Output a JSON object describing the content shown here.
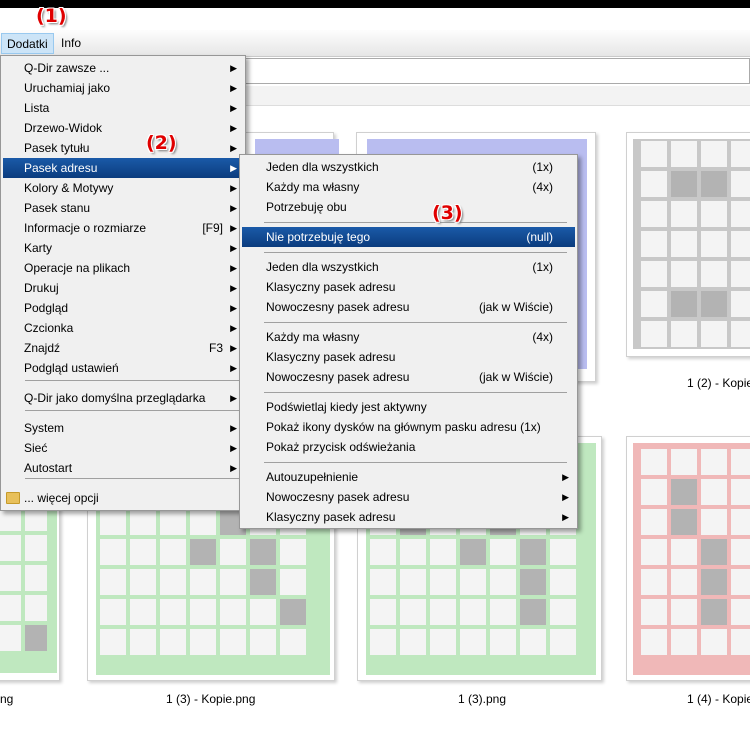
{
  "annotations": {
    "a1": "(1)",
    "a2": "(2)",
    "a3": "(3)"
  },
  "menubar": {
    "dodatki": "Dodatki",
    "info": "Info"
  },
  "main_menu": {
    "items": [
      {
        "label": "Q-Dir zawsze ...",
        "shortcut": "",
        "arrow": "▶"
      },
      {
        "label": "Uruchamiaj jako",
        "shortcut": "",
        "arrow": "▶"
      },
      {
        "label": "Lista",
        "shortcut": "",
        "arrow": "▶"
      },
      {
        "label": "Drzewo-Widok",
        "shortcut": "",
        "arrow": "▶"
      },
      {
        "label": "Pasek tytułu",
        "shortcut": "",
        "arrow": "▶"
      },
      {
        "label": "Pasek adresu",
        "shortcut": "",
        "arrow": "▶"
      },
      {
        "label": "Kolory & Motywy",
        "shortcut": "",
        "arrow": "▶"
      },
      {
        "label": "Pasek stanu",
        "shortcut": "",
        "arrow": "▶"
      },
      {
        "label": "Informacje o rozmiarze",
        "shortcut": "[F9]",
        "arrow": "▶"
      },
      {
        "label": "Karty",
        "shortcut": "",
        "arrow": "▶"
      },
      {
        "label": "Operacje na plikach",
        "shortcut": "",
        "arrow": "▶"
      },
      {
        "label": "Drukuj",
        "shortcut": "",
        "arrow": "▶"
      },
      {
        "label": "Podgląd",
        "shortcut": "",
        "arrow": "▶"
      },
      {
        "label": "Czcionka",
        "shortcut": "",
        "arrow": "▶"
      },
      {
        "label": "Znajdź",
        "shortcut": "F3",
        "arrow": "▶"
      },
      {
        "label": "Podgląd ustawień",
        "shortcut": "",
        "arrow": "▶"
      },
      {
        "label": "Q-Dir jako domyślna przeglądarka",
        "shortcut": "",
        "arrow": "▶"
      },
      {
        "label": "System",
        "shortcut": "",
        "arrow": "▶"
      },
      {
        "label": "Sieć",
        "shortcut": "",
        "arrow": "▶"
      },
      {
        "label": "Autostart",
        "shortcut": "",
        "arrow": "▶"
      },
      {
        "label": "... więcej opcji",
        "shortcut": "",
        "arrow": ""
      }
    ]
  },
  "submenu": {
    "items": [
      {
        "label": "Jeden dla wszystkich",
        "value": "(1x)",
        "arrow": ""
      },
      {
        "label": "Każdy ma własny",
        "value": "(4x)",
        "arrow": ""
      },
      {
        "label": "Potrzebuję obu",
        "value": "",
        "arrow": ""
      },
      {
        "label": "Nie potrzebuję tego",
        "value": "(null)",
        "arrow": ""
      },
      {
        "label": "Jeden dla wszystkich",
        "value": "(1x)",
        "arrow": ""
      },
      {
        "label": "Klasyczny pasek adresu",
        "value": "",
        "arrow": ""
      },
      {
        "label": "Nowoczesny pasek adresu",
        "value": "(jak w Wiście)",
        "arrow": ""
      },
      {
        "label": "Każdy ma własny",
        "value": "(4x)",
        "arrow": ""
      },
      {
        "label": "Klasyczny pasek adresu",
        "value": "",
        "arrow": ""
      },
      {
        "label": "Nowoczesny pasek adresu",
        "value": "(jak w Wiście)",
        "arrow": ""
      },
      {
        "label": "Podświetlaj kiedy jest aktywny",
        "value": "",
        "arrow": ""
      },
      {
        "label": "Pokaż ikony dysków na głównym pasku adresu (1x)",
        "value": "",
        "arrow": ""
      },
      {
        "label": "Pokaż przycisk odświeżania",
        "value": "",
        "arrow": ""
      },
      {
        "label": "Autouzupełnienie",
        "value": "",
        "arrow": "▶"
      },
      {
        "label": "Nowoczesny pasek adresu",
        "value": "",
        "arrow": "▶"
      },
      {
        "label": "Klasyczny pasek adresu",
        "value": "",
        "arrow": "▶"
      }
    ]
  },
  "files": {
    "captions": [
      "1 (2) - Kopie",
      "ng",
      "1 (3) - Kopie.png",
      "1 (3).png",
      "1 (4) - Kopie"
    ]
  },
  "colors": {
    "highlight": "#0b3c7e",
    "blue_shadow": "#b9bdf0",
    "grey_shadow": "#c8c8c8",
    "green_shadow": "#bfe8bf",
    "red_shadow": "#f0b8b8"
  }
}
